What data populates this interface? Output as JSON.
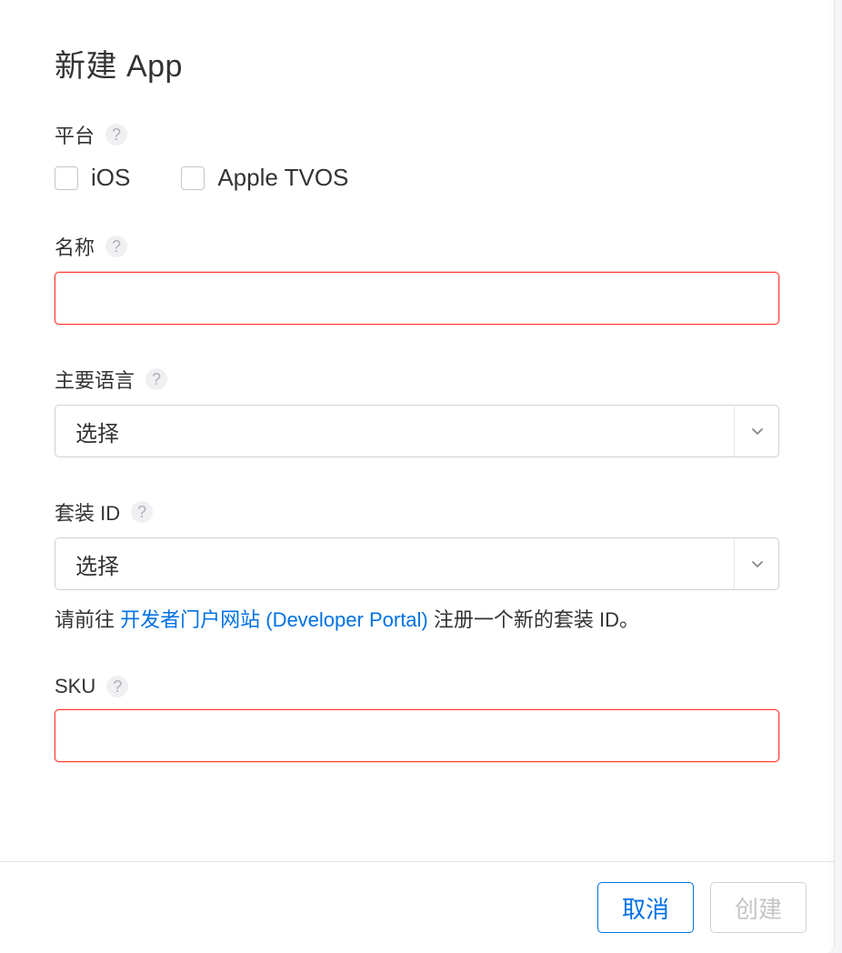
{
  "title": "新建 App",
  "platform": {
    "label": "平台",
    "options": {
      "ios": "iOS",
      "tvos": "Apple TVOS"
    }
  },
  "name": {
    "label": "名称",
    "value": ""
  },
  "language": {
    "label": "主要语言",
    "selected": "选择"
  },
  "bundle": {
    "label": "套装 ID",
    "selected": "选择",
    "hint_prefix": "请前往 ",
    "hint_link": "开发者门户网站 (Developer Portal)",
    "hint_suffix": " 注册一个新的套装 ID。"
  },
  "sku": {
    "label": "SKU",
    "value": ""
  },
  "footer": {
    "cancel": "取消",
    "create": "创建"
  },
  "help_glyph": "?"
}
